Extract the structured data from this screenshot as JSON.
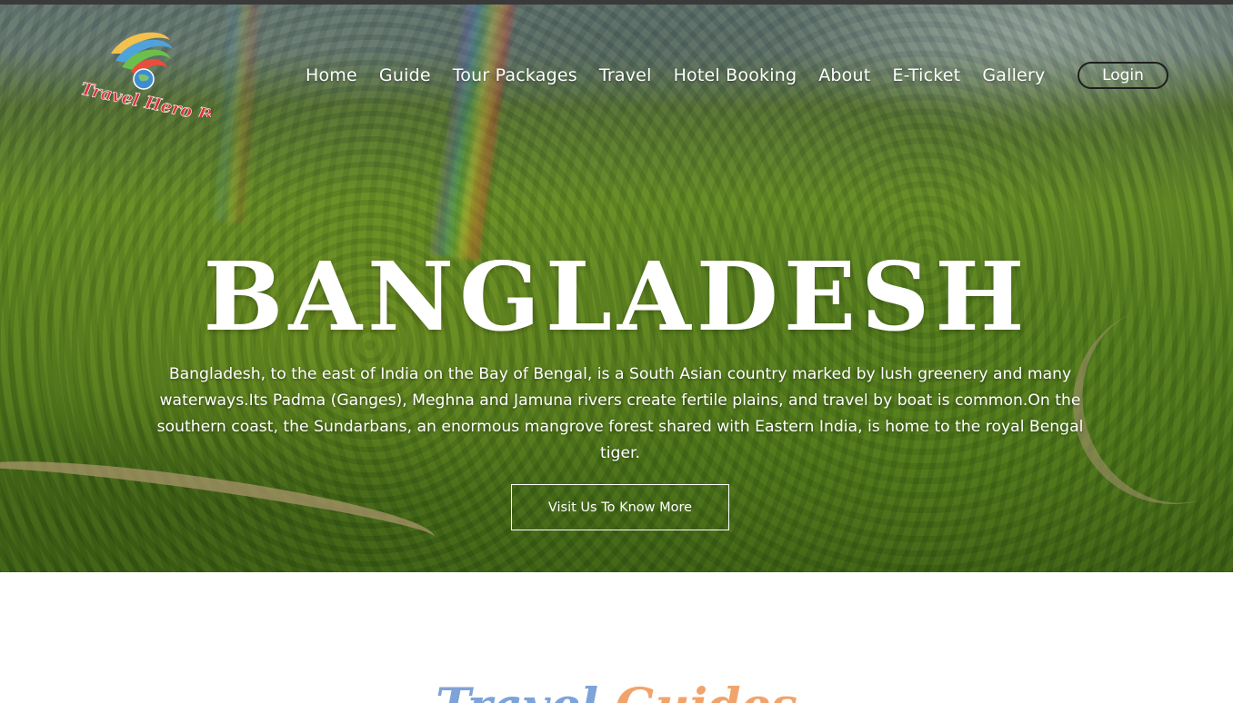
{
  "brand": {
    "logo_text": "Travel Hero BD"
  },
  "nav": {
    "items": [
      "Home",
      "Guide",
      "Tour Packages",
      "Travel",
      "Hotel Booking",
      "About",
      "E-Ticket",
      "Gallery"
    ],
    "login_label": "Login"
  },
  "hero": {
    "title": "BANGLADESH",
    "description": "Bangladesh, to the east of India on the Bay of Bengal, is a South Asian country marked by lush greenery and many waterways.Its Padma (Ganges), Meghna and Jamuna rivers create fertile plains, and travel by boat is common.On the southern coast, the Sundarbans, an enormous mangrove forest shared with Eastern India, is home to the royal Bengal tiger.",
    "cta_label": "Visit Us To Know More"
  },
  "section": {
    "title_part1": "Travel",
    "title_part2": "Guides"
  },
  "colors": {
    "title_part1": "#7ea3d8",
    "title_part2": "#f0a46c",
    "hero_text": "#ffffff"
  },
  "icons": {
    "logo": "globe-swoosh-logo"
  }
}
